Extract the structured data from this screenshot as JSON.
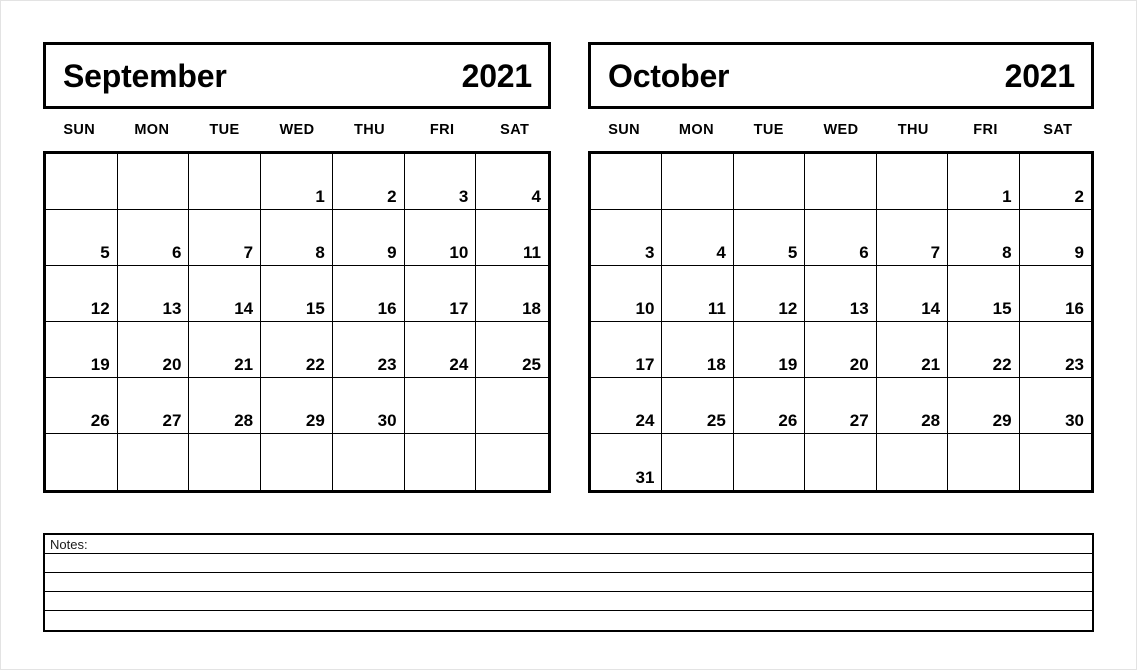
{
  "page": {
    "title": "September October 2021 Two Month Calendar"
  },
  "calendars": [
    {
      "id": "september",
      "month": "September",
      "year": "2021",
      "weekday_headers": [
        "SUN",
        "MON",
        "TUE",
        "WED",
        "THU",
        "FRI",
        "SAT"
      ],
      "weeks": [
        [
          "",
          "",
          "",
          "1",
          "2",
          "3",
          "4"
        ],
        [
          "5",
          "6",
          "7",
          "8",
          "9",
          "10",
          "11"
        ],
        [
          "12",
          "13",
          "14",
          "15",
          "16",
          "17",
          "18"
        ],
        [
          "19",
          "20",
          "21",
          "22",
          "23",
          "24",
          "25"
        ],
        [
          "26",
          "27",
          "28",
          "29",
          "30",
          "",
          ""
        ],
        [
          "",
          "",
          "",
          "",
          "",
          "",
          ""
        ]
      ]
    },
    {
      "id": "october",
      "month": "October",
      "year": "2021",
      "weekday_headers": [
        "SUN",
        "MON",
        "TUE",
        "WED",
        "THU",
        "FRI",
        "SAT"
      ],
      "weeks": [
        [
          "",
          "",
          "",
          "",
          "",
          "1",
          "2"
        ],
        [
          "3",
          "4",
          "5",
          "6",
          "7",
          "8",
          "9"
        ],
        [
          "10",
          "11",
          "12",
          "13",
          "14",
          "15",
          "16"
        ],
        [
          "17",
          "18",
          "19",
          "20",
          "21",
          "22",
          "23"
        ],
        [
          "24",
          "25",
          "26",
          "27",
          "28",
          "29",
          "30"
        ],
        [
          "31",
          "",
          "",
          "",
          "",
          "",
          ""
        ]
      ]
    }
  ],
  "notes": {
    "label": "Notes:",
    "line_count": 5
  },
  "colors": {
    "ink": "#000000",
    "paper": "#ffffff",
    "page_border": "#e3e3e3"
  }
}
